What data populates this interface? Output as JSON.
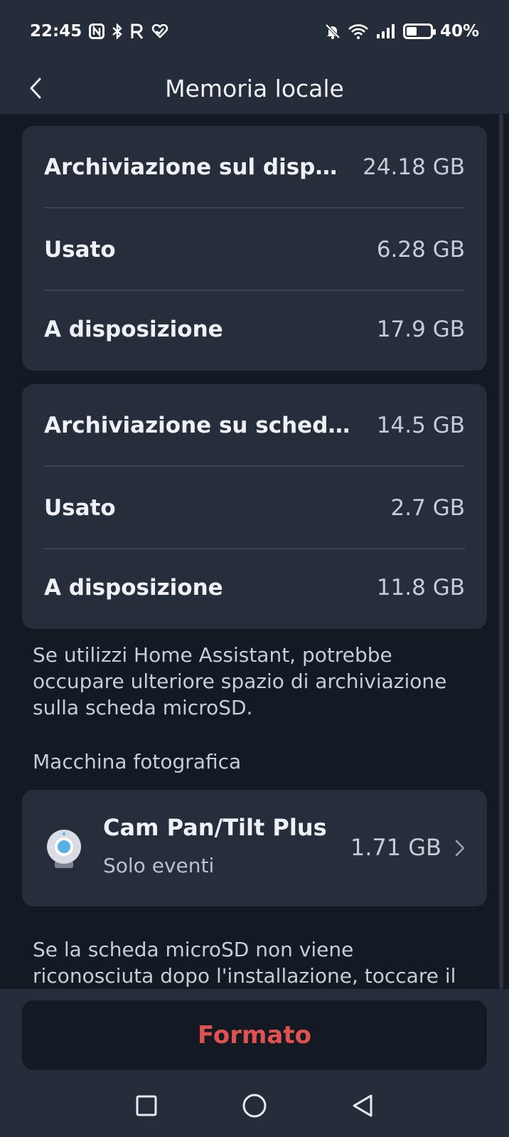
{
  "status_bar": {
    "time": "22:45",
    "battery": "40%",
    "battery_level": 0.4,
    "icons_left": [
      "nfc-icon",
      "bluetooth-icon",
      "r-app-icon",
      "heart-app-icon"
    ],
    "icons_right": [
      "bell-muted-icon",
      "wifi-icon",
      "signal-icon",
      "battery-icon"
    ]
  },
  "header": {
    "title": "Memoria locale"
  },
  "device_storage": {
    "rows": [
      {
        "label": "Archiviazione sul dispositivo",
        "value": "24.18 GB"
      },
      {
        "label": "Usato",
        "value": "6.28 GB"
      },
      {
        "label": "A  disposizione",
        "value": "17.9 GB"
      }
    ]
  },
  "sd_storage": {
    "rows": [
      {
        "label": "Archiviazione su scheda microSD",
        "value": "14.5 GB"
      },
      {
        "label": "Usato",
        "value": "2.7 GB"
      },
      {
        "label": "A  disposizione",
        "value": "11.8 GB"
      }
    ]
  },
  "notes": {
    "home_assistant": "Se utilizzi Home Assistant, potrebbe occupare ulteriore spazio di archiviazione sulla scheda microSD.",
    "camera_section": "Macchina fotografica",
    "microsd_hint": "Se la scheda microSD non viene riconosciuta dopo l'installazione, toccare il"
  },
  "camera": {
    "name": "Cam Pan/Tilt Plus",
    "mode": "Solo  eventi",
    "size": "1.71 GB"
  },
  "actions": {
    "format_label": "Formato"
  },
  "colors": {
    "background": "#141a24",
    "card": "#262e3c",
    "header": "#252d3a",
    "accent_red": "#e0524f",
    "camera_lens": "#5ab0e6"
  }
}
